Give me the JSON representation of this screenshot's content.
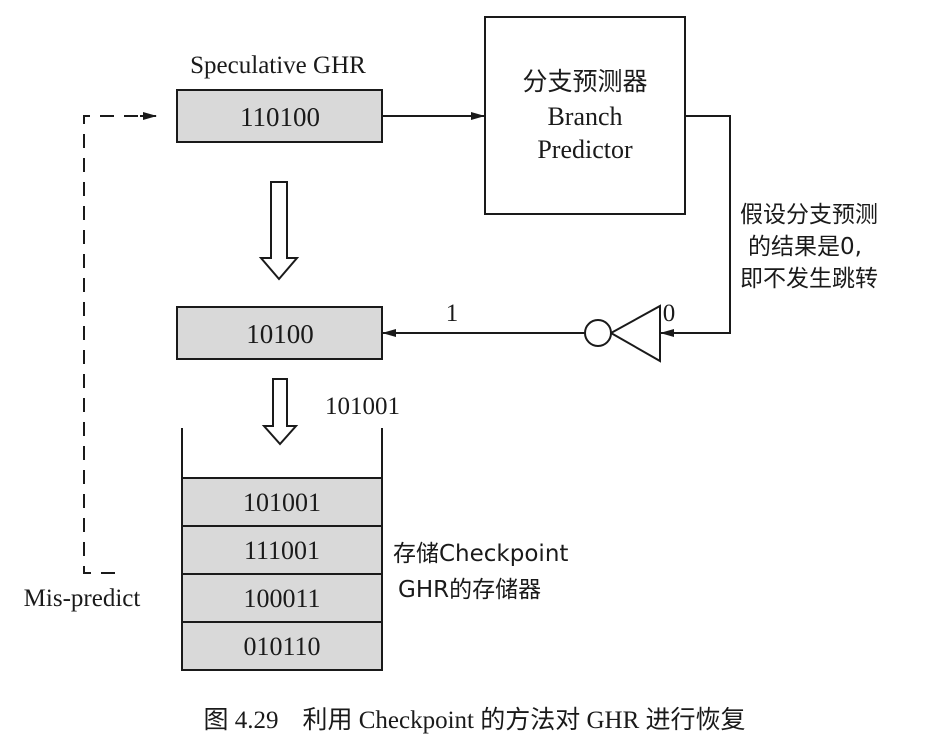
{
  "colors": {
    "register_fill": "#d9d9d9",
    "line": "#1a1a1a",
    "background": "#ffffff"
  },
  "speculative_ghr": {
    "label": "Speculative GHR",
    "value": "110100"
  },
  "branch_predictor": {
    "label_cn": "分支预测器",
    "label_en_line1": "Branch",
    "label_en_line2": "Predictor"
  },
  "prediction_note": {
    "line1": "假设分支预测",
    "line2": "的结果是0,",
    "line3": "即不发生跳转"
  },
  "inverter": {
    "input_label": "0",
    "output_label": "1"
  },
  "shifted_ghr": {
    "value": "10100",
    "pushed_value": "101001"
  },
  "checkpoint_store": {
    "label_line1": "存储Checkpoint",
    "label_line2": "GHR的存储器",
    "entries": [
      "101001",
      "111001",
      "100011",
      "010110"
    ]
  },
  "mispredict": {
    "label": "Mis-predict"
  },
  "caption": {
    "number": "图 4.29",
    "text": "利用 Checkpoint 的方法对 GHR 进行恢复"
  }
}
